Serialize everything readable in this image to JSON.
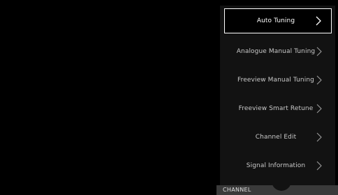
{
  "menu": {
    "items": [
      {
        "label": "Auto Tuning",
        "selected": true
      },
      {
        "label": "Analogue Manual Tuning",
        "selected": false
      },
      {
        "label": "Freeview Manual Tuning",
        "selected": false
      },
      {
        "label": "Freeview Smart Retune",
        "selected": false
      },
      {
        "label": "Channel Edit",
        "selected": false
      },
      {
        "label": "Signal Information",
        "selected": false
      }
    ],
    "chevron_icon": "chevron-right-icon"
  },
  "footer": {
    "section_label": "CHANNEL"
  },
  "colors": {
    "background": "#000000",
    "panel": "#121212",
    "footer_bar": "#3a3a3a",
    "selected_border": "#ffffff",
    "text": "#c9c9c9"
  }
}
